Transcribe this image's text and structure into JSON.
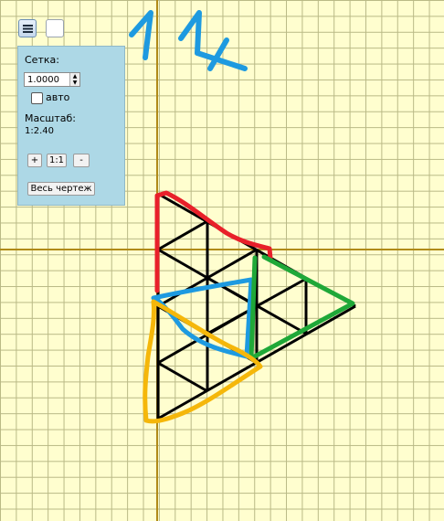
{
  "toolbar": {
    "menu_icon": "hamburger-icon"
  },
  "panel": {
    "grid_label": "Сетка:",
    "grid_value": "1.0000",
    "auto_label": "авто",
    "auto_checked": false,
    "scale_label": "Масштаб:",
    "scale_value": "1:2.40",
    "zoom_in_label": "+",
    "zoom_reset_label": "1:1",
    "zoom_out_label": "-",
    "fit_all_label": "Весь чертеж"
  },
  "canvas": {
    "background_color": "#fffecf",
    "grid_color": "#b9b986",
    "axis_color": "#b08a18",
    "stroke_colors": {
      "red": "#e8202a",
      "blue": "#1e9ae0",
      "green": "#1fa838",
      "yellow": "#f5b70a",
      "black": "#000000"
    }
  }
}
